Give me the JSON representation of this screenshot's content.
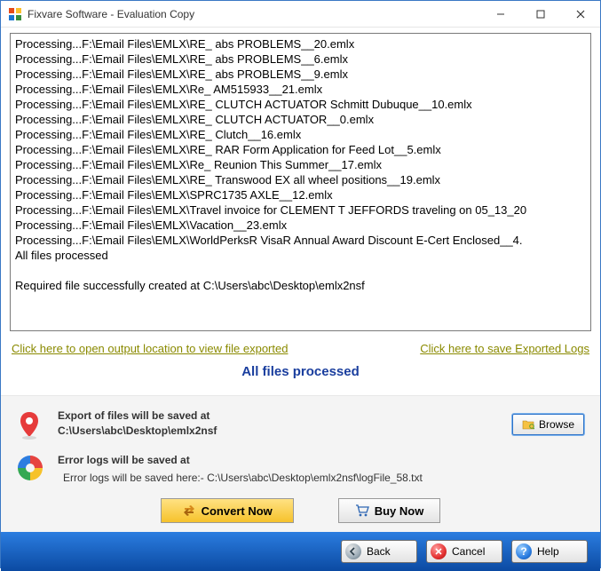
{
  "window": {
    "title": "Fixvare Software - Evaluation Copy"
  },
  "log_lines": [
    "Processing...F:\\Email Files\\EMLX\\RE_ abs PROBLEMS__20.emlx",
    "Processing...F:\\Email Files\\EMLX\\RE_ abs PROBLEMS__6.emlx",
    "Processing...F:\\Email Files\\EMLX\\RE_ abs PROBLEMS__9.emlx",
    "Processing...F:\\Email Files\\EMLX\\Re_ AM515933__21.emlx",
    "Processing...F:\\Email Files\\EMLX\\RE_ CLUTCH ACTUATOR Schmitt Dubuque__10.emlx",
    "Processing...F:\\Email Files\\EMLX\\RE_ CLUTCH ACTUATOR__0.emlx",
    "Processing...F:\\Email Files\\EMLX\\RE_ Clutch__16.emlx",
    "Processing...F:\\Email Files\\EMLX\\RE_ RAR Form Application for Feed Lot__5.emlx",
    "Processing...F:\\Email Files\\EMLX\\Re_ Reunion This Summer__17.emlx",
    "Processing...F:\\Email Files\\EMLX\\RE_ Transwood EX all wheel positions__19.emlx",
    "Processing...F:\\Email Files\\EMLX\\SPRC1735 AXLE__12.emlx",
    "Processing...F:\\Email Files\\EMLX\\Travel invoice for CLEMENT T JEFFORDS traveling on 05_13_20",
    "Processing...F:\\Email Files\\EMLX\\Vacation__23.emlx",
    "Processing...F:\\Email Files\\EMLX\\WorldPerksR VisaR Annual Award Discount E-Cert Enclosed__4.",
    "All files processed",
    "",
    "Required file successfully created at C:\\Users\\abc\\Desktop\\emlx2nsf"
  ],
  "links": {
    "open_output": "Click here to open output location to view file exported",
    "save_logs": "Click here to save Exported Logs"
  },
  "status_text": "All files processed",
  "export_section": {
    "line1": "Export of files will be saved at",
    "line2": "C:\\Users\\abc\\Desktop\\emlx2nsf",
    "browse_label": "Browse"
  },
  "error_section": {
    "line1": "Error logs will be saved at",
    "line2": "Error logs will be saved here:- C:\\Users\\abc\\Desktop\\emlx2nsf\\logFile_58.txt"
  },
  "buttons": {
    "convert": "Convert Now",
    "buy": "Buy Now",
    "back": "Back",
    "cancel": "Cancel",
    "help": "Help"
  }
}
